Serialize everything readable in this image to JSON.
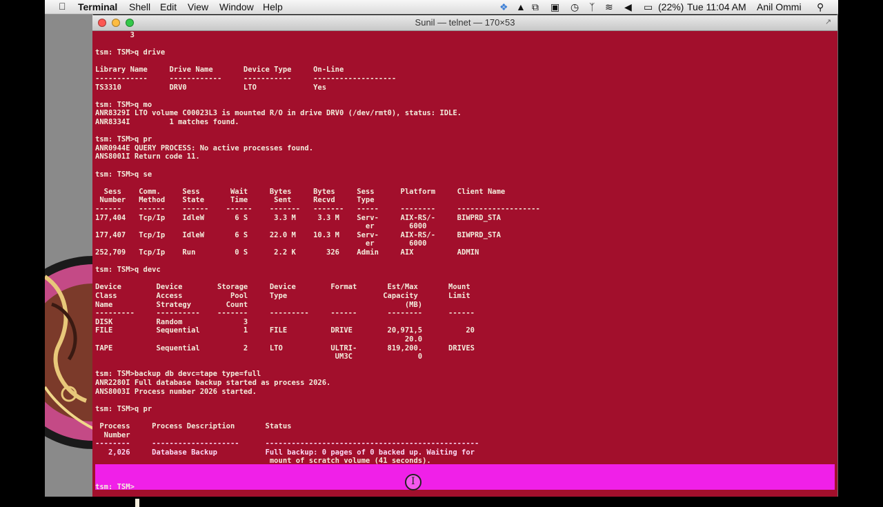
{
  "menubar": {
    "app": "Terminal",
    "items": [
      "Shell",
      "Edit",
      "View",
      "Window",
      "Help"
    ],
    "battery": "(22%)",
    "clock": "Tue 11:04 AM",
    "user": "Anil Ommi"
  },
  "window": {
    "title": "Sunil — telnet — 170×53"
  },
  "terminal": {
    "lines": [
      "        3",
      "",
      "tsm: TSM>q drive",
      "",
      "Library Name     Drive Name       Device Type     On-Line",
      "------------     ------------     -----------     -------------------",
      "TS3310           DRV0             LTO             Yes",
      "",
      "tsm: TSM>q mo",
      "ANR8329I LTO volume C00023L3 is mounted R/O in drive DRV0 (/dev/rmt0), status: IDLE.",
      "ANR8334I         1 matches found.",
      "",
      "tsm: TSM>q pr",
      "ANR0944E QUERY PROCESS: No active processes found.",
      "ANS8001I Return code 11.",
      "",
      "tsm: TSM>q se",
      "",
      "  Sess    Comm.     Sess       Wait     Bytes     Bytes     Sess      Platform     Client Name",
      " Number   Method    State      Time      Sent     Recvd     Type",
      "------    ------    ------    ------    -------   -------   -----     --------     -------------------",
      "177,404   Tcp/Ip    IdleW       6 S      3.3 M     3.3 M    Serv-     AIX-RS/-     BIWPRD_STA",
      "                                                              er        6000",
      "177,407   Tcp/Ip    IdleW       6 S     22.0 M    10.3 M    Serv-     AIX-RS/-     BIWPRD_STA",
      "                                                              er        6000",
      "252,709   Tcp/Ip    Run         0 S      2.2 K       326    Admin     AIX          ADMIN",
      "",
      "tsm: TSM>q devc",
      "",
      "Device        Device        Storage     Device        Format       Est/Max       Mount",
      "Class         Access           Pool     Type                      Capacity       Limit",
      "Name          Strategy        Count                                    (MB)",
      "---------     ----------    -------     ---------     ------       --------      ------",
      "DISK          Random              3",
      "FILE          Sequential          1     FILE          DRIVE        20,971,5          20",
      "                                                                       20.0",
      "TAPE          Sequential          2     LTO           ULTRI-       819,200.      DRIVES",
      "                                                       UM3C               0",
      "",
      "tsm: TSM>backup db devc=tape type=full",
      "ANR2280I Full database backup started as process 2026.",
      "ANS8003I Process number 2026 started.",
      "",
      "tsm: TSM>q pr",
      "",
      " Process     Process Description       Status",
      "  Number",
      "--------     --------------------      -------------------------------------------------",
      "   2,026     Database Backup           Full backup: 0 pages of 0 backed up. Waiting for",
      "                                        mount of scratch volume (41 seconds).",
      "",
      "",
      "tsm: TSM>"
    ]
  },
  "colors": {
    "terminal_bg": "#a20f2c",
    "terminal_fg": "#f3ecdc",
    "highlight": "#f020e8"
  },
  "icons": [
    "apple-icon",
    "dropbox-icon",
    "drive-icon",
    "screen-icon",
    "time-machine-icon",
    "bluetooth-icon",
    "wifi-icon",
    "volume-icon",
    "battery-icon",
    "spotlight-icon"
  ]
}
